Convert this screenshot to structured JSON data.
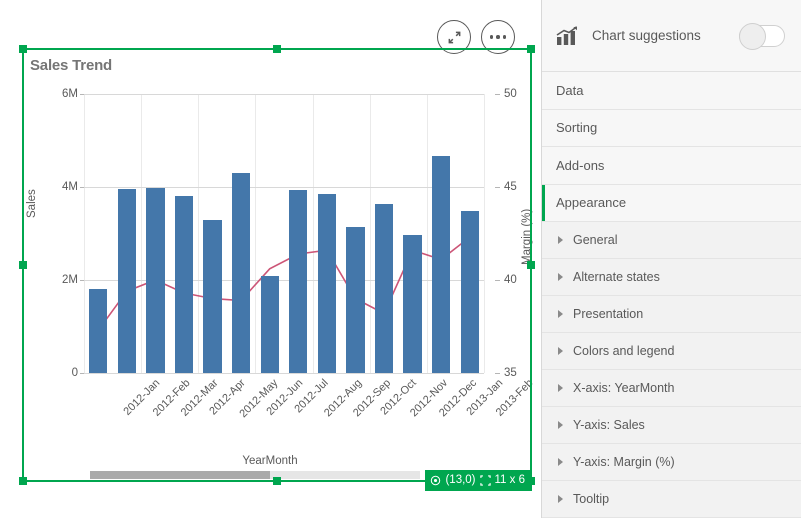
{
  "chart": {
    "title": "Sales Trend",
    "xaxis_title": "YearMonth",
    "yaxis_left_label": "Sales",
    "yaxis_right_label": "Margin (%)",
    "y_left_ticks": [
      "0",
      "2M",
      "4M",
      "6M"
    ],
    "y_right_ticks": [
      "35",
      "40",
      "45",
      "50"
    ]
  },
  "chart_data": {
    "type": "bar",
    "title": "Sales Trend",
    "xlabel": "YearMonth",
    "ylabel": "Sales",
    "y2label": "Margin (%)",
    "grid": true,
    "legend": "none",
    "categories": [
      "2012-Jan",
      "2012-Feb",
      "2012-Mar",
      "2012-Apr",
      "2012-May",
      "2012-Jun",
      "2012-Jul",
      "2012-Aug",
      "2012-Sep",
      "2012-Oct",
      "2012-Nov",
      "2012-Dec",
      "2013-Jan",
      "2013-Feb"
    ],
    "series": [
      {
        "name": "Sales",
        "type": "bar",
        "axis": "left",
        "color": "#4477aa",
        "values": [
          1800000,
          3960000,
          3980000,
          3810000,
          3280000,
          4300000,
          2090000,
          3940000,
          3850000,
          3130000,
          3630000,
          2960000,
          4670000,
          3480000
        ]
      },
      {
        "name": "Margin (%)",
        "type": "line",
        "axis": "right",
        "color": "#cc5577",
        "values": [
          37.3,
          39.4,
          40.0,
          39.3,
          39.0,
          38.9,
          40.6,
          41.4,
          41.6,
          39.0,
          38.2,
          41.6,
          41.1,
          42.3
        ]
      }
    ],
    "ylim": [
      0,
      6000000
    ],
    "y2lim": [
      35,
      50
    ],
    "y_ticks": [
      0,
      2000000,
      4000000,
      6000000
    ],
    "y_tick_labels": [
      "0",
      "2M",
      "4M",
      "6M"
    ],
    "y2_ticks": [
      35,
      40,
      45,
      50
    ],
    "y2_tick_labels": [
      "35",
      "40",
      "45",
      "50"
    ]
  },
  "toolbar": {
    "expand_icon": "expand-arrows-icon",
    "more_icon": "ellipsis-icon"
  },
  "selection": {
    "position": "(13,0)",
    "size": "11 x 6",
    "position_icon": "target-icon",
    "size_icon": "resize-icon",
    "accent_color": "#00a64f"
  },
  "sidebar": {
    "suggestions": {
      "label": "Chart suggestions",
      "icon": "chart-trend-icon",
      "toggle_state": "off"
    },
    "sections": [
      {
        "label": "Data",
        "selected": false
      },
      {
        "label": "Sorting",
        "selected": false
      },
      {
        "label": "Add-ons",
        "selected": false
      },
      {
        "label": "Appearance",
        "selected": true
      }
    ],
    "appearance_items": [
      {
        "label": "General"
      },
      {
        "label": "Alternate states"
      },
      {
        "label": "Presentation"
      },
      {
        "label": "Colors and legend"
      },
      {
        "label": "X-axis: YearMonth"
      },
      {
        "label": "Y-axis: Sales"
      },
      {
        "label": "Y-axis: Margin (%)"
      },
      {
        "label": "Tooltip"
      }
    ]
  }
}
